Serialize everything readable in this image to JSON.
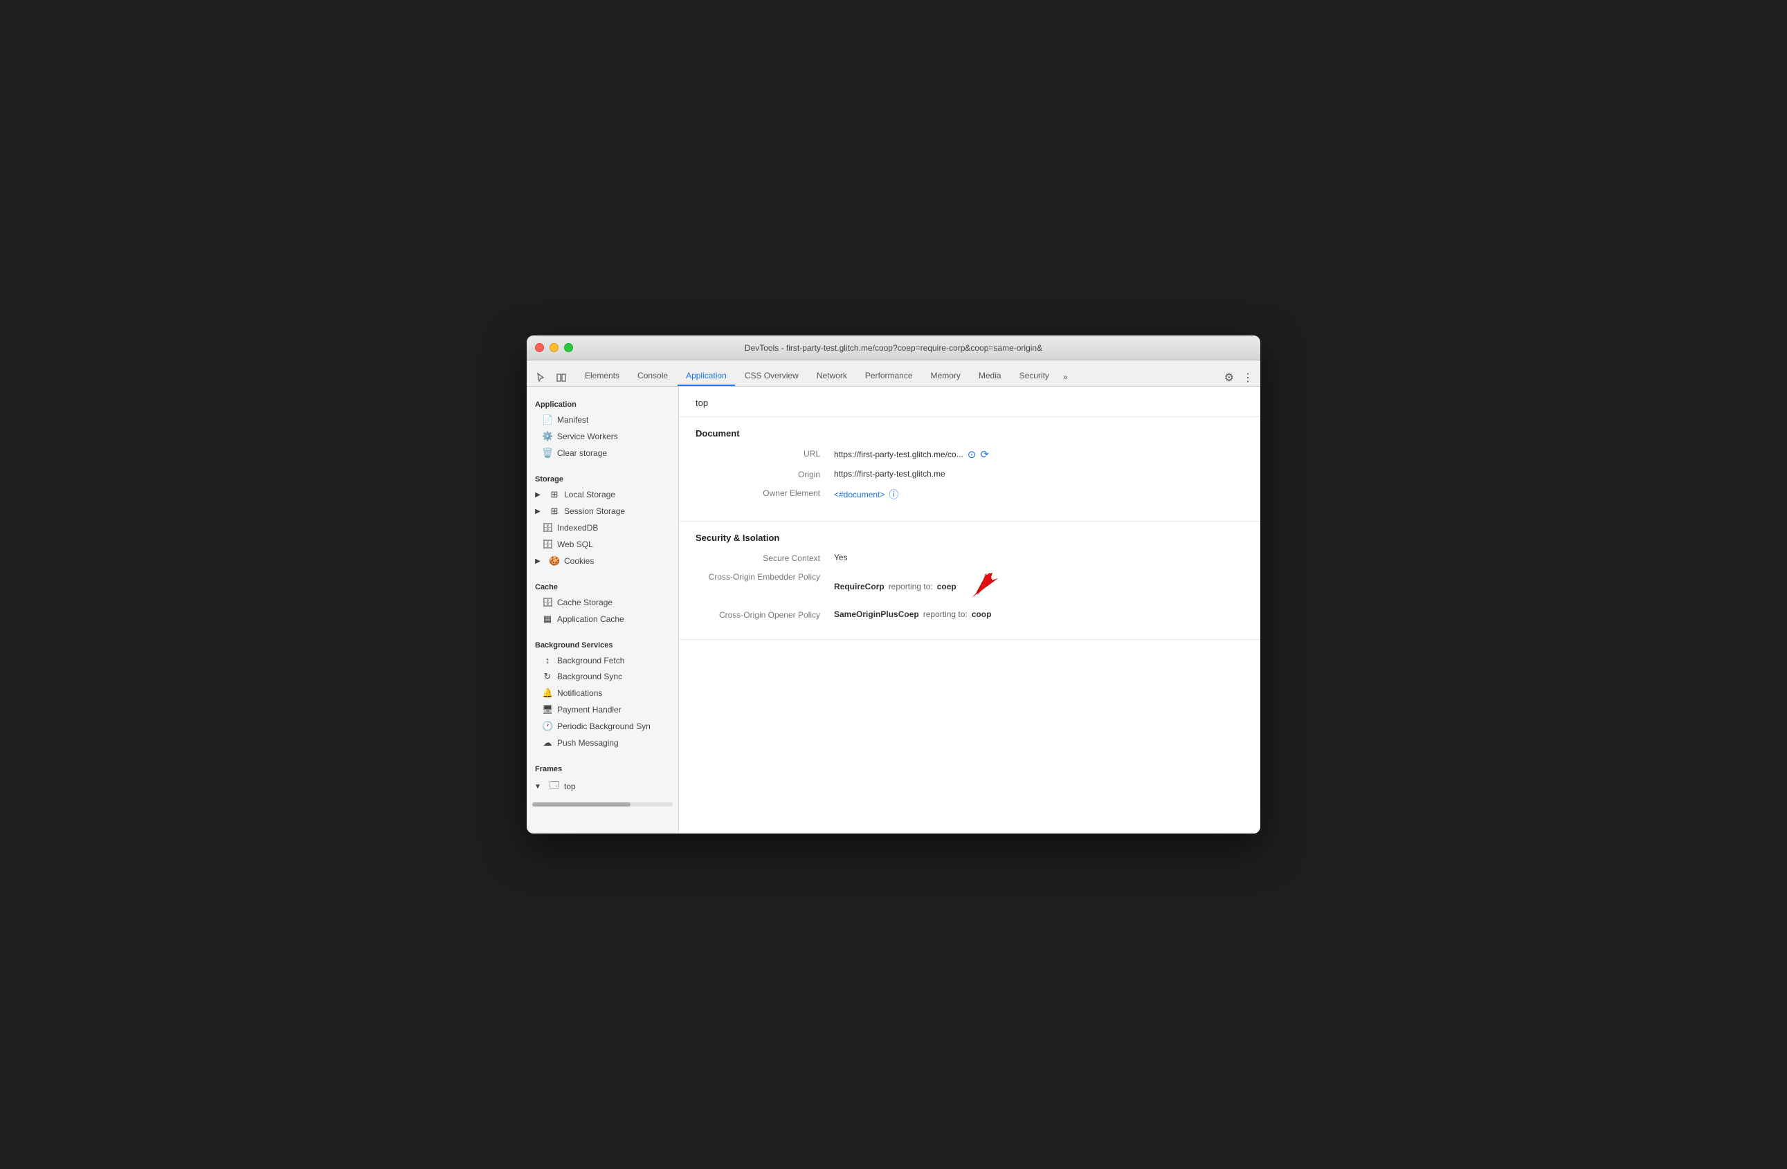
{
  "window": {
    "title": "DevTools - first-party-test.glitch.me/coop?coep=require-corp&coop=same-origin&"
  },
  "tabs": [
    {
      "id": "elements",
      "label": "Elements",
      "active": false
    },
    {
      "id": "console",
      "label": "Console",
      "active": false
    },
    {
      "id": "application",
      "label": "Application",
      "active": true
    },
    {
      "id": "css-overview",
      "label": "CSS Overview",
      "active": false
    },
    {
      "id": "network",
      "label": "Network",
      "active": false
    },
    {
      "id": "performance",
      "label": "Performance",
      "active": false
    },
    {
      "id": "memory",
      "label": "Memory",
      "active": false
    },
    {
      "id": "media",
      "label": "Media",
      "active": false
    },
    {
      "id": "security",
      "label": "Security",
      "active": false
    }
  ],
  "sidebar": {
    "sections": [
      {
        "label": "Application",
        "items": [
          {
            "id": "manifest",
            "icon": "📄",
            "label": "Manifest"
          },
          {
            "id": "service-workers",
            "icon": "⚙️",
            "label": "Service Workers"
          },
          {
            "id": "clear-storage",
            "icon": "🗑️",
            "label": "Clear storage"
          }
        ]
      },
      {
        "label": "Storage",
        "items": [
          {
            "id": "local-storage",
            "icon": "▶",
            "label": "Local Storage",
            "collapsible": true,
            "has_grid": true
          },
          {
            "id": "session-storage",
            "icon": "▶",
            "label": "Session Storage",
            "collapsible": true,
            "has_grid": true
          },
          {
            "id": "indexed-db",
            "icon": "🗄",
            "label": "IndexedDB"
          },
          {
            "id": "web-sql",
            "icon": "🗄",
            "label": "Web SQL"
          },
          {
            "id": "cookies",
            "icon": "▶",
            "label": "Cookies",
            "collapsible": true
          }
        ]
      },
      {
        "label": "Cache",
        "items": [
          {
            "id": "cache-storage",
            "icon": "🗄",
            "label": "Cache Storage"
          },
          {
            "id": "application-cache",
            "icon": "▦",
            "label": "Application Cache"
          }
        ]
      },
      {
        "label": "Background Services",
        "items": [
          {
            "id": "background-fetch",
            "icon": "↕",
            "label": "Background Fetch"
          },
          {
            "id": "background-sync",
            "icon": "↻",
            "label": "Background Sync"
          },
          {
            "id": "notifications",
            "icon": "🔔",
            "label": "Notifications"
          },
          {
            "id": "payment-handler",
            "icon": "🖥",
            "label": "Payment Handler"
          },
          {
            "id": "periodic-background-sync",
            "icon": "🕐",
            "label": "Periodic Background Syn"
          },
          {
            "id": "push-messaging",
            "icon": "☁",
            "label": "Push Messaging"
          }
        ]
      },
      {
        "label": "Frames",
        "items": [
          {
            "id": "top-frame",
            "icon": "▼",
            "label": "top",
            "collapsible": true
          }
        ]
      }
    ]
  },
  "content": {
    "page_label": "top",
    "document_section": {
      "title": "Document",
      "fields": [
        {
          "label": "URL",
          "value": "https://first-party-test.glitch.me/co...",
          "has_link_icons": true
        },
        {
          "label": "Origin",
          "value": "https://first-party-test.glitch.me"
        },
        {
          "label": "Owner Element",
          "value": "<#document>",
          "is_link": true,
          "has_info_icon": true
        }
      ]
    },
    "security_section": {
      "title": "Security & Isolation",
      "fields": [
        {
          "label": "Secure Context",
          "value": "Yes"
        },
        {
          "label": "Cross-Origin Embedder Policy",
          "value": "RequireCorp",
          "reporting": "reporting to:",
          "reporting_value": "coep",
          "has_red_arrow": true
        },
        {
          "label": "Cross-Origin Opener Policy",
          "value": "SameOriginPlusCoep",
          "reporting": "reporting to:",
          "reporting_value": "coop"
        }
      ]
    }
  }
}
